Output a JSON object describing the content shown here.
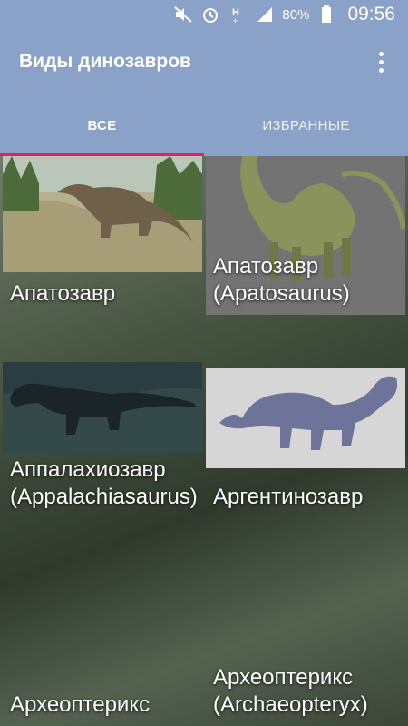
{
  "status_bar": {
    "battery": "80%",
    "time": "09:56",
    "icons": [
      "mute-icon",
      "alarm-icon",
      "h-plus-icon",
      "signal-icon",
      "battery-icon"
    ]
  },
  "app_bar": {
    "title": "Виды динозавров"
  },
  "tabs": [
    {
      "label": "ВСЕ",
      "active": true
    },
    {
      "label": "ИЗБРАННЫЕ",
      "active": false
    }
  ],
  "cards": [
    {
      "label": "Апатозавр"
    },
    {
      "label": "Апатозавр (Apatosaurus)"
    },
    {
      "label": "Аппалахиозавр (Appalachiasaurus)"
    },
    {
      "label": "Аргентинозавр"
    },
    {
      "label": "Археоптерикс"
    },
    {
      "label": "Археоптерикс (Archaeopteryx)"
    }
  ],
  "colors": {
    "app_bar": "#8aa2c8",
    "tab_indicator": "#e0245e"
  }
}
